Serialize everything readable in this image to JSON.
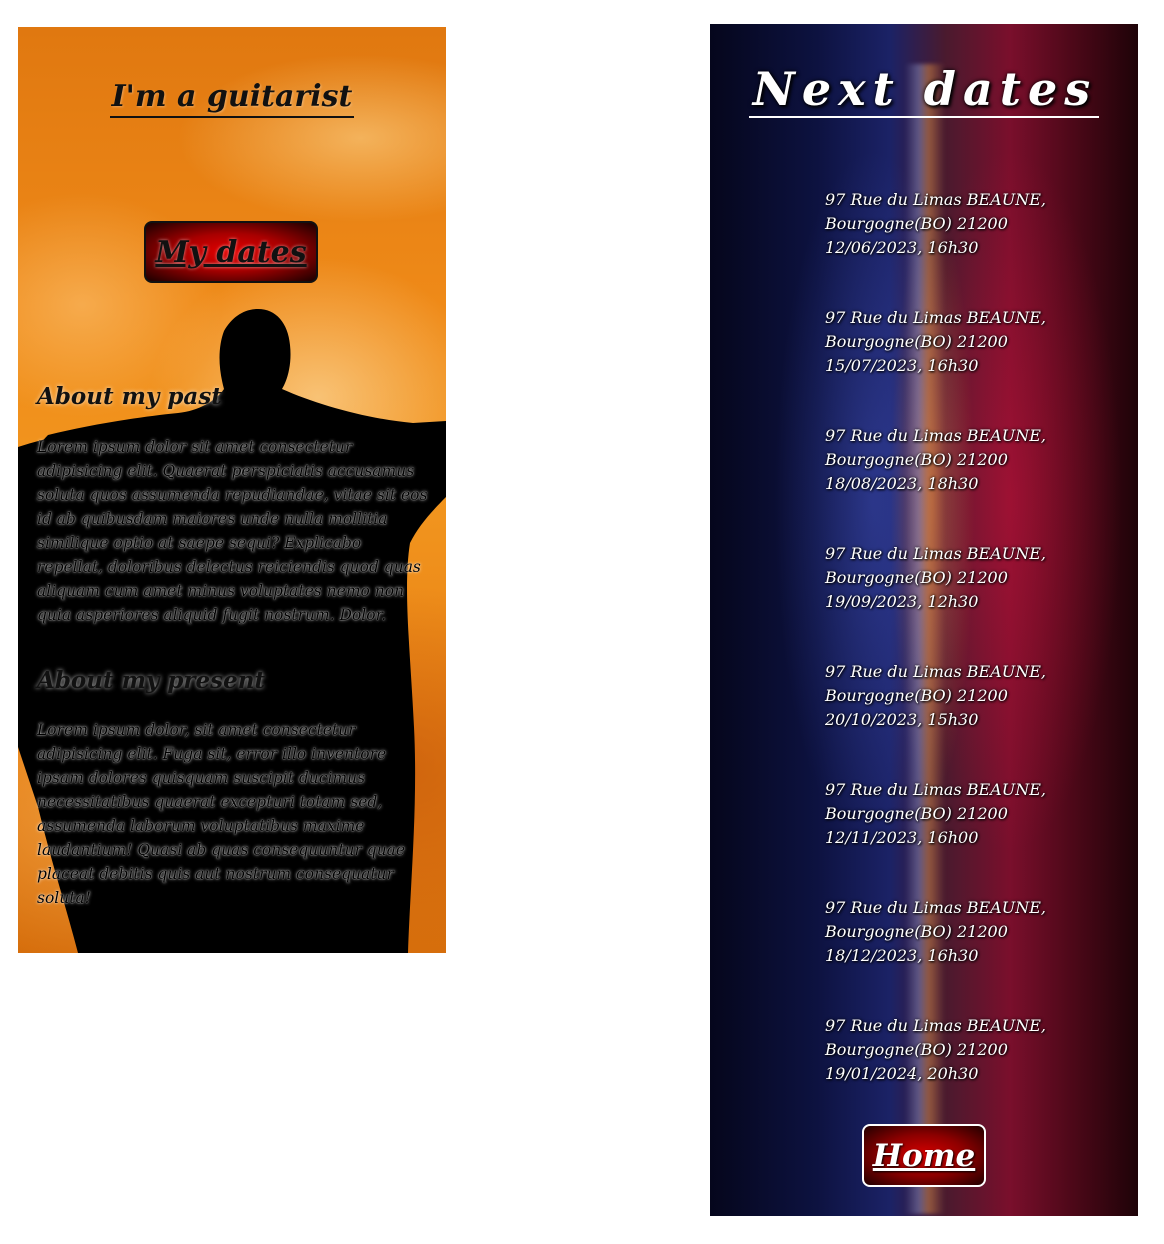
{
  "guitarist_page": {
    "title": "I'm a guitarist",
    "dates_button": "My dates",
    "past": {
      "heading": "About my past",
      "text": "Lorem ipsum dolor sit amet consectetur adipisicing elit. Quaerat perspiciatis accusamus soluta quos assumenda repudiandae, vitae sit eos id ab quibusdam maiores unde nulla mollitia similique optio at saepe sequi? Explicabo repellat, doloribus delectus reiciendis quod quas aliquam cum amet minus voluptates nemo non quia asperiores aliquid fugit nostrum. Dolor."
    },
    "present": {
      "heading": "About my present",
      "text": "Lorem ipsum dolor, sit amet consectetur adipisicing elit. Fuga sit, error illo inventore ipsam dolores quisquam suscipit ducimus necessitatibus quaerat excepturi totam sed, assumenda laborum voluptatibus maxime laudantium! Quasi ab quas consequuntur quae placeat debitis quis aut nostrum consequatur soluta!"
    }
  },
  "dates_page": {
    "title": "Next dates",
    "dates": [
      {
        "address": "97 Rue du Limas BEAUNE,",
        "region": "Bourgogne(BO) 21200",
        "when": "12/06/2023, 16h30"
      },
      {
        "address": "97 Rue du Limas BEAUNE,",
        "region": "Bourgogne(BO) 21200",
        "when": "15/07/2023, 16h30"
      },
      {
        "address": "97 Rue du Limas BEAUNE,",
        "region": "Bourgogne(BO) 21200",
        "when": "18/08/2023, 18h30"
      },
      {
        "address": "97 Rue du Limas BEAUNE,",
        "region": "Bourgogne(BO) 21200",
        "when": "19/09/2023, 12h30"
      },
      {
        "address": "97 Rue du Limas BEAUNE,",
        "region": "Bourgogne(BO) 21200",
        "when": "20/10/2023, 15h30"
      },
      {
        "address": "97 Rue du Limas BEAUNE,",
        "region": "Bourgogne(BO) 21200",
        "when": "12/11/2023, 16h00"
      },
      {
        "address": "97 Rue du Limas BEAUNE,",
        "region": "Bourgogne(BO) 21200",
        "when": "18/12/2023, 16h30"
      },
      {
        "address": "97 Rue du Limas BEAUNE,",
        "region": "Bourgogne(BO) 21200",
        "when": "19/01/2024, 20h30"
      }
    ],
    "home_button": "Home"
  }
}
